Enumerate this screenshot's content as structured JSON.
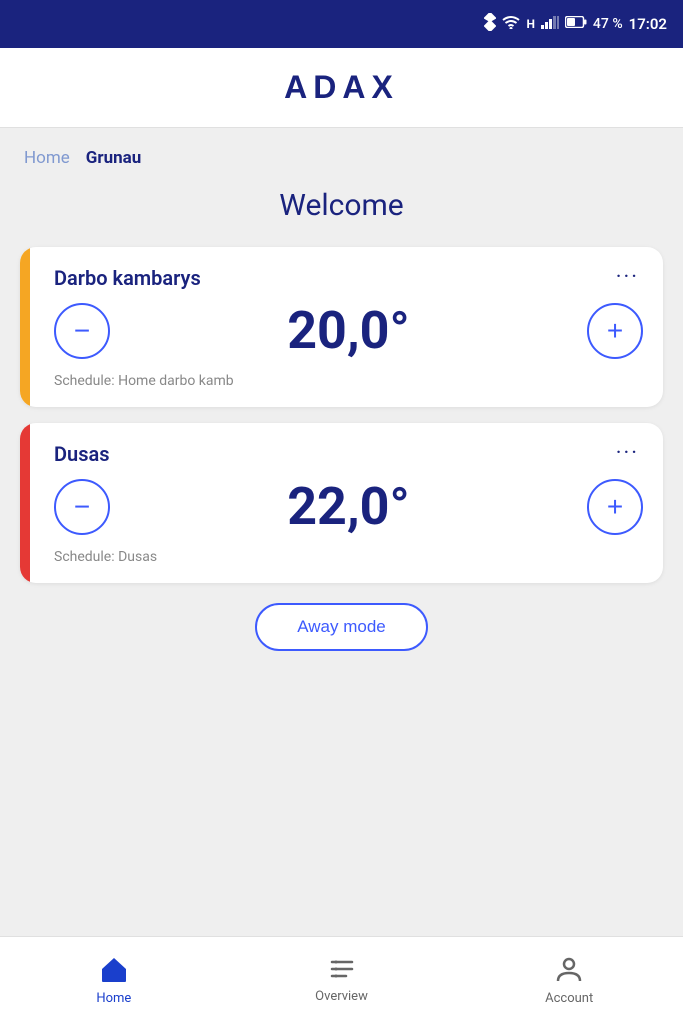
{
  "status_bar": {
    "battery": "47 %",
    "time": "17:02",
    "icons": [
      "bluetooth",
      "wifi",
      "h-signal",
      "signal-bars",
      "battery"
    ]
  },
  "header": {
    "logo": "ADAX"
  },
  "breadcrumb": {
    "home_label": "Home",
    "current_label": "Grunau"
  },
  "welcome": {
    "title": "Welcome"
  },
  "devices": [
    {
      "id": "darbo",
      "name": "Darbo kambarys",
      "temperature": "20,0°",
      "schedule": "Schedule: Home darbo kamb",
      "indicator_color": "yellow",
      "menu_label": "···"
    },
    {
      "id": "dusas",
      "name": "Dusas",
      "temperature": "22,0°",
      "schedule": "Schedule: Dusas",
      "indicator_color": "red",
      "menu_label": "···"
    }
  ],
  "away_mode": {
    "label": "Away mode"
  },
  "bottom_nav": {
    "items": [
      {
        "id": "home",
        "label": "Home",
        "active": true
      },
      {
        "id": "overview",
        "label": "Overview",
        "active": false
      },
      {
        "id": "account",
        "label": "Account",
        "active": false
      }
    ]
  },
  "controls": {
    "minus_label": "−",
    "plus_label": "+"
  }
}
